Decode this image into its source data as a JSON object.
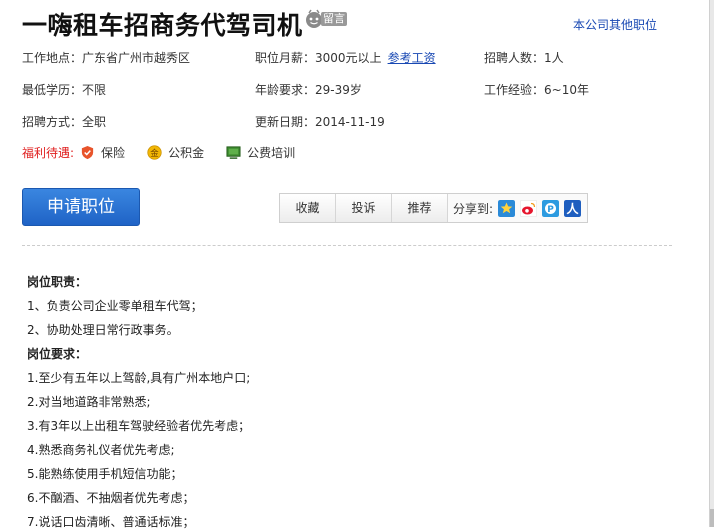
{
  "job_title": "一嗨租车招商务代驾司机",
  "message_badge": "留言",
  "other_positions_link": "本公司其他职位",
  "info": {
    "location_label": "工作地点：",
    "location": "广东省广州市越秀区",
    "salary_label": "职位月薪：",
    "salary": "3000元以上",
    "salary_ref_link": "参考工资",
    "headcount_label": "招聘人数：",
    "headcount": "1人",
    "education_label": "最低学历：",
    "education": "不限",
    "age_label": "年龄要求：",
    "age": "29-39岁",
    "experience_label": "工作经验：",
    "experience": "6~10年",
    "employment_label": "招聘方式：",
    "employment": "全职",
    "updated_label": "更新日期：",
    "updated": "2014-11-19"
  },
  "welfare": {
    "label": "福利待遇:",
    "items": [
      {
        "label": "保险",
        "icon": "insurance-icon",
        "color": "#e8542b"
      },
      {
        "label": "公积金",
        "icon": "gold-coin-icon",
        "color": "#f2b705"
      },
      {
        "label": "公费培训",
        "icon": "training-board-icon",
        "color": "#3d8b2f"
      }
    ]
  },
  "actions": {
    "apply": "申请职位",
    "favorite": "收藏",
    "complain": "投诉",
    "recommend": "推荐",
    "share_label": "分享到:"
  },
  "share_icons": [
    {
      "name": "qzone-share-icon",
      "color": "#2a8ad8"
    },
    {
      "name": "weibo-share-icon",
      "color": "#e6162d"
    },
    {
      "name": "pengyou-share-icon",
      "color": "#2d9be0"
    },
    {
      "name": "renren-share-icon",
      "color": "#1e5ebf"
    }
  ],
  "description": [
    {
      "text": "岗位职责：",
      "bold": true
    },
    {
      "text": "1、负责公司企业零单租车代驾；",
      "bold": false
    },
    {
      "text": "2、协助处理日常行政事务。",
      "bold": false
    },
    {
      "text": "岗位要求：",
      "bold": true
    },
    {
      "text": "1.至少有五年以上驾龄,具有广州本地户口;",
      "bold": false
    },
    {
      "text": "2.对当地道路非常熟悉;",
      "bold": false
    },
    {
      "text": "3.有3年以上出租车驾驶经验者优先考虑；",
      "bold": false
    },
    {
      "text": "4.熟悉商务礼仪者优先考虑;",
      "bold": false
    },
    {
      "text": "5.能熟练使用手机短信功能；",
      "bold": false
    },
    {
      "text": "6.不酗酒、不抽烟者优先考虑；",
      "bold": false
    },
    {
      "text": "7.说话口齿清晰、普通话标准；",
      "bold": false
    }
  ]
}
